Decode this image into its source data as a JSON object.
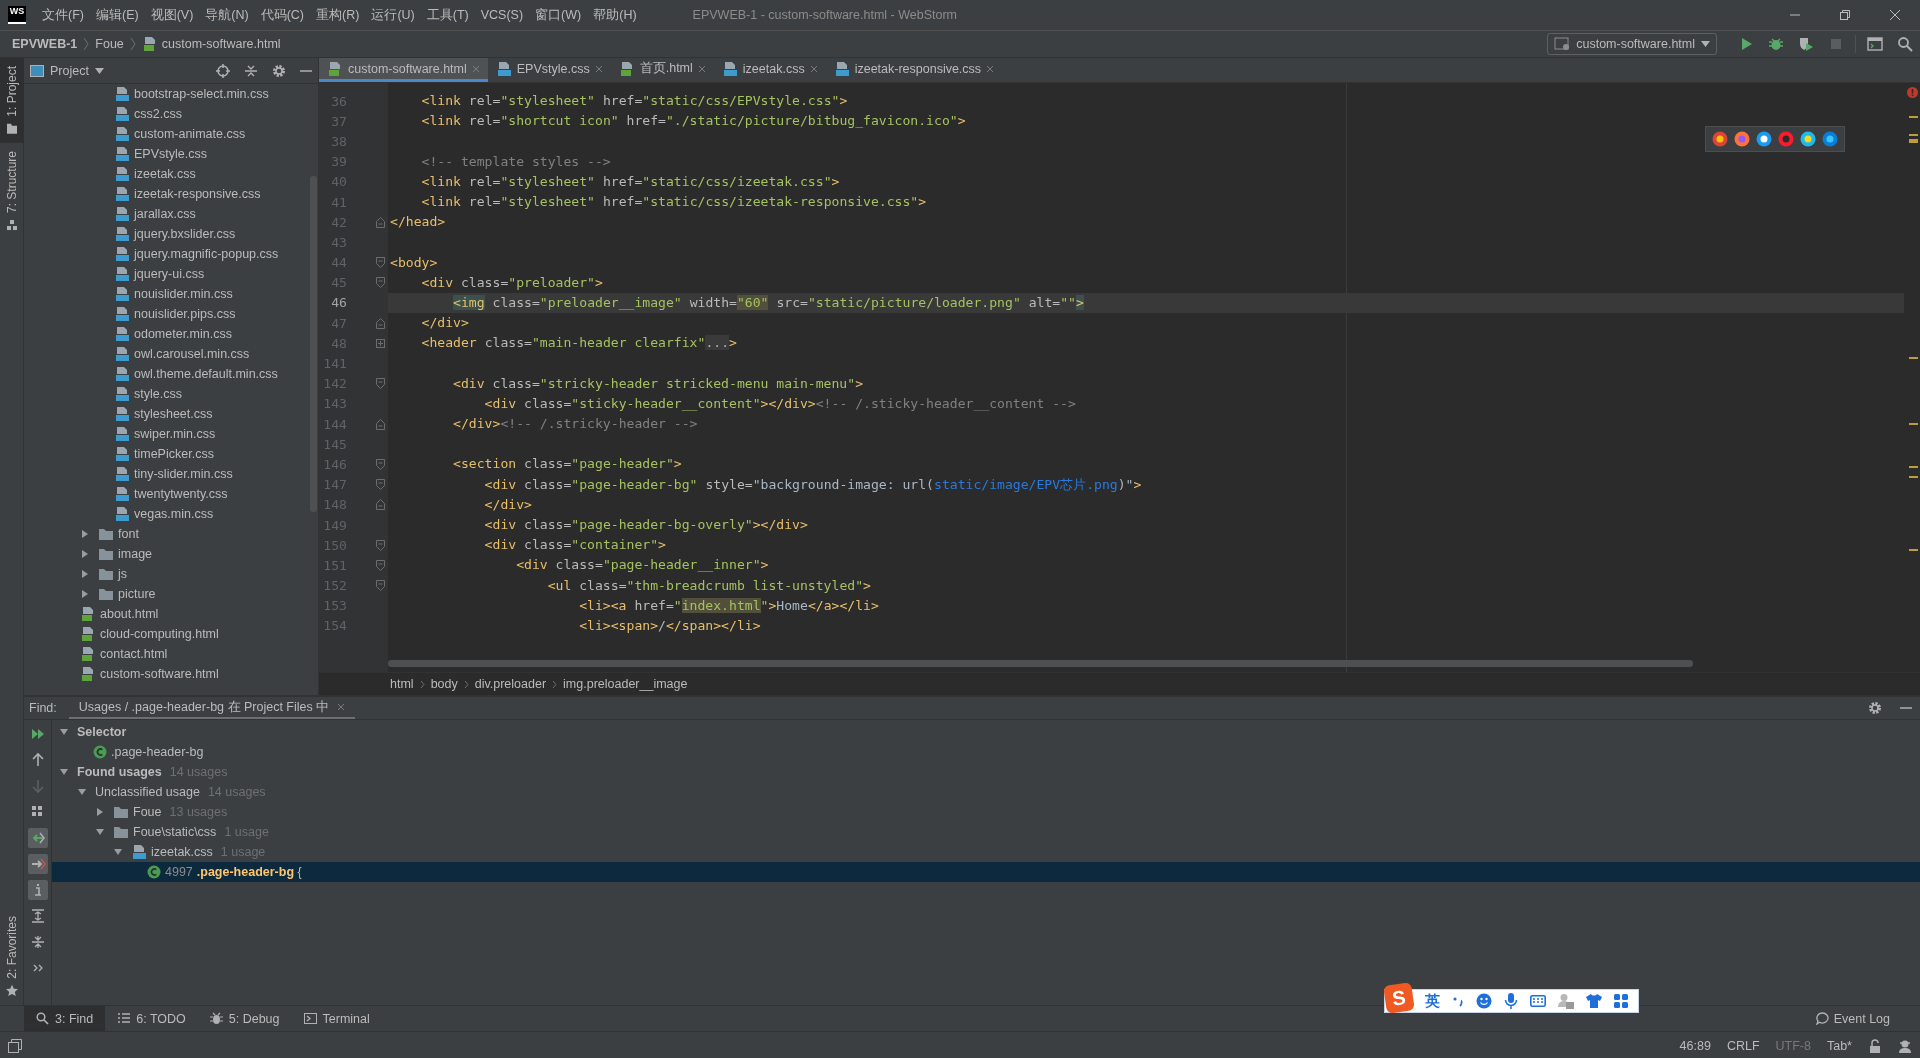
{
  "menu_bar": {
    "logo": "WS",
    "items": [
      "文件(F)",
      "编辑(E)",
      "视图(V)",
      "导航(N)",
      "代码(C)",
      "重构(R)",
      "运行(U)",
      "工具(T)",
      "VCS(S)",
      "窗口(W)",
      "帮助(H)"
    ],
    "title": "EPVWEB-1 - custom-software.html - WebStorm"
  },
  "nav_bar": {
    "breadcrumbs": [
      {
        "label": "EPVWEB-1",
        "kind": "project"
      },
      {
        "label": "Foue",
        "kind": "folder"
      },
      {
        "label": "custom-software.html",
        "kind": "html"
      }
    ],
    "run_config": "custom-software.html",
    "buttons": [
      {
        "kind": "run",
        "disabled": false
      },
      {
        "kind": "debug",
        "disabled": false
      },
      {
        "kind": "coverage",
        "disabled": false
      },
      {
        "kind": "stop",
        "disabled": true
      },
      {
        "kind": "terminal",
        "disabled": false
      },
      {
        "kind": "search",
        "disabled": false
      }
    ]
  },
  "side_strip": {
    "top": [
      {
        "label": "1: Project",
        "kind": "project",
        "selected": true
      },
      {
        "label": "7: Structure",
        "kind": "structure",
        "selected": false
      }
    ],
    "bottom": [
      {
        "label": "2: Favorites",
        "kind": "favorites",
        "selected": false
      }
    ]
  },
  "project_panel": {
    "title": "Project",
    "tree": [
      {
        "children": [
          {
            "children": [
              {
                "label": "bootstrap-select.min.css",
                "kind": "css"
              },
              {
                "label": "css2.css",
                "kind": "css"
              },
              {
                "label": "custom-animate.css",
                "kind": "css"
              },
              {
                "label": "EPVstyle.css",
                "kind": "css"
              },
              {
                "label": "izeetak.css",
                "kind": "css"
              },
              {
                "label": "izeetak-responsive.css",
                "kind": "css"
              },
              {
                "label": "jarallax.css",
                "kind": "css"
              },
              {
                "label": "jquery.bxslider.css",
                "kind": "css"
              },
              {
                "label": "jquery.magnific-popup.css",
                "kind": "css"
              },
              {
                "label": "jquery-ui.css",
                "kind": "css"
              },
              {
                "label": "nouislider.min.css",
                "kind": "css"
              },
              {
                "label": "nouislider.pips.css",
                "kind": "css"
              },
              {
                "label": "odometer.min.css",
                "kind": "css"
              },
              {
                "label": "owl.carousel.min.css",
                "kind": "css"
              },
              {
                "label": "owl.theme.default.min.css",
                "kind": "css"
              },
              {
                "label": "style.css",
                "kind": "css"
              },
              {
                "label": "stylesheet.css",
                "kind": "css"
              },
              {
                "label": "swiper.min.css",
                "kind": "css"
              },
              {
                "label": "timePicker.css",
                "kind": "css"
              },
              {
                "label": "tiny-slider.min.css",
                "kind": "css"
              },
              {
                "label": "twentytwenty.css",
                "kind": "css"
              },
              {
                "label": "vegas.min.css",
                "kind": "css"
              }
            ]
          }
        ]
      },
      {
        "label": "font",
        "kind": "folder",
        "expanded": false
      },
      {
        "label": "image",
        "kind": "folder",
        "expanded": false
      },
      {
        "label": "js",
        "kind": "folder",
        "expanded": false
      },
      {
        "label": "picture",
        "kind": "folder",
        "expanded": false
      },
      {
        "label": "about.html",
        "kind": "html"
      },
      {
        "label": "cloud-computing.html",
        "kind": "html"
      },
      {
        "label": "contact.html",
        "kind": "html"
      },
      {
        "label": "custom-software.html",
        "kind": "html"
      }
    ]
  },
  "editor_tabs": [
    {
      "label": "custom-software.html",
      "kind": "html",
      "selected": true
    },
    {
      "label": "EPVstyle.css",
      "kind": "css",
      "selected": false
    },
    {
      "label": "首页.html",
      "kind": "html",
      "selected": false
    },
    {
      "label": "izeetak.css",
      "kind": "css",
      "selected": false
    },
    {
      "label": "izeetak-responsive.css",
      "kind": "css",
      "selected": false
    }
  ],
  "editor": {
    "lines": [
      {
        "number": "36",
        "current": false,
        "segments": [
          {
            "kind": "tag",
            "text": "    <link "
          },
          {
            "kind": "attr",
            "text": "rel="
          },
          {
            "kind": "str",
            "text": "\"stylesheet\""
          },
          {
            "kind": "attr",
            "text": " href="
          },
          {
            "kind": "str",
            "text": "\"static/css/EPVstyle.css\""
          },
          {
            "kind": "tag",
            "text": ">"
          }
        ]
      },
      {
        "number": "37",
        "current": false,
        "segments": [
          {
            "kind": "tag",
            "text": "    <link "
          },
          {
            "kind": "attr",
            "text": "rel="
          },
          {
            "kind": "str",
            "text": "\"shortcut icon\""
          },
          {
            "kind": "attr",
            "text": " href="
          },
          {
            "kind": "str",
            "text": "\"./static/picture/bitbug_favicon.ico\""
          },
          {
            "kind": "tag",
            "text": ">"
          }
        ]
      },
      {
        "number": "38",
        "current": false,
        "kind": "plain"
      },
      {
        "number": "39",
        "current": false,
        "segments": [
          {
            "kind": "comment",
            "text": "    <!-- template styles -->"
          }
        ]
      },
      {
        "number": "40",
        "current": false,
        "segments": [
          {
            "kind": "tag",
            "text": "    <link "
          },
          {
            "kind": "attr",
            "text": "rel="
          },
          {
            "kind": "str",
            "text": "\"stylesheet\""
          },
          {
            "kind": "attr",
            "text": " href="
          },
          {
            "kind": "str",
            "text": "\"static/css/izeetak.css\""
          },
          {
            "kind": "tag",
            "text": ">"
          }
        ]
      },
      {
        "number": "41",
        "current": false,
        "segments": [
          {
            "kind": "tag",
            "text": "    <link "
          },
          {
            "kind": "attr",
            "text": "rel="
          },
          {
            "kind": "str",
            "text": "\"stylesheet\""
          },
          {
            "kind": "attr",
            "text": " href="
          },
          {
            "kind": "str",
            "text": "\"static/css/izeetak-responsive.css\""
          },
          {
            "kind": "tag",
            "text": ">"
          }
        ]
      },
      {
        "number": "42",
        "current": false,
        "kind": "fold_end",
        "segments": [
          {
            "kind": "tag",
            "text": "</head>"
          }
        ]
      },
      {
        "number": "43",
        "current": false,
        "kind": "plain"
      },
      {
        "number": "44",
        "current": false,
        "kind": "fold_start",
        "segments": [
          {
            "kind": "tag",
            "text": "<body>"
          }
        ]
      },
      {
        "number": "45",
        "current": false,
        "kind": "fold_start",
        "segments": [
          {
            "kind": "tag",
            "text": "    <div "
          },
          {
            "kind": "attr",
            "text": "class="
          },
          {
            "kind": "str",
            "text": "\"preloader\""
          },
          {
            "kind": "tag",
            "text": ">"
          }
        ]
      },
      {
        "number": "46",
        "current": true,
        "segments": [
          {
            "kind": "match",
            "text": "        <img"
          },
          {
            "kind": "attr",
            "text": " class="
          },
          {
            "kind": "str",
            "text": "\"preloader__image\""
          },
          {
            "kind": "attr",
            "text": " width="
          },
          {
            "kind": "str_hl",
            "text": "\"60\""
          },
          {
            "kind": "attr",
            "text": " src="
          },
          {
            "kind": "str",
            "text": "\"static/picture/loader.png\""
          },
          {
            "kind": "attr",
            "text": " alt="
          },
          {
            "kind": "str",
            "text": "\"\""
          },
          {
            "kind": "match",
            "text": ">"
          }
        ]
      },
      {
        "number": "47",
        "current": false,
        "kind": "fold_end",
        "segments": [
          {
            "kind": "tag",
            "text": "    </div>"
          }
        ]
      },
      {
        "number": "48",
        "current": false,
        "kind": "collapsed",
        "segments": [
          {
            "kind": "tag",
            "text": "    <header "
          },
          {
            "kind": "attr",
            "text": "class="
          },
          {
            "kind": "str",
            "text": "\"main-header clearfix\""
          },
          {
            "kind": "folded",
            "text": "..."
          },
          {
            "kind": "tag",
            "text": ">"
          }
        ]
      },
      {
        "number": "141",
        "current": false,
        "kind": "plain"
      },
      {
        "number": "142",
        "current": false,
        "kind": "fold_start",
        "segments": [
          {
            "kind": "tag",
            "text": "        <div "
          },
          {
            "kind": "attr",
            "text": "class="
          },
          {
            "kind": "str",
            "text": "\"stricky-header stricked-menu main-menu\""
          },
          {
            "kind": "tag",
            "text": ">"
          }
        ]
      },
      {
        "number": "143",
        "current": false,
        "segments": [
          {
            "kind": "tag",
            "text": "            <div "
          },
          {
            "kind": "attr",
            "text": "class="
          },
          {
            "kind": "str",
            "text": "\"sticky-header__content\""
          },
          {
            "kind": "tag",
            "text": "></div>"
          },
          {
            "kind": "comment",
            "text": "<!-- /.sticky-header__content -->"
          }
        ]
      },
      {
        "number": "144",
        "current": false,
        "kind": "fold_end",
        "segments": [
          {
            "kind": "tag",
            "text": "        </div>"
          },
          {
            "kind": "comment",
            "text": "<!-- /.stricky-header -->"
          }
        ]
      },
      {
        "number": "145",
        "current": false,
        "kind": "plain"
      },
      {
        "number": "146",
        "current": false,
        "kind": "fold_start",
        "segments": [
          {
            "kind": "tag",
            "text": "        <section "
          },
          {
            "kind": "attr",
            "text": "class="
          },
          {
            "kind": "str",
            "text": "\"page-header\""
          },
          {
            "kind": "tag",
            "text": ">"
          }
        ]
      },
      {
        "number": "147",
        "current": false,
        "kind": "fold_start",
        "segments": [
          {
            "kind": "tag",
            "text": "            <div "
          },
          {
            "kind": "attr",
            "text": "class="
          },
          {
            "kind": "str",
            "text": "\"page-header-bg\""
          },
          {
            "kind": "attr",
            "text": " style="
          },
          {
            "kind": "text",
            "text": "\"background-image: url("
          },
          {
            "kind": "url",
            "text": "static/image/EPV芯片.png"
          },
          {
            "kind": "text",
            "text": ")\""
          },
          {
            "kind": "tag",
            "text": ">"
          }
        ]
      },
      {
        "number": "148",
        "current": false,
        "kind": "fold_end",
        "segments": [
          {
            "kind": "tag",
            "text": "            </div>"
          }
        ]
      },
      {
        "number": "149",
        "current": false,
        "segments": [
          {
            "kind": "tag",
            "text": "            <div "
          },
          {
            "kind": "attr",
            "text": "class="
          },
          {
            "kind": "str",
            "text": "\"page-header-bg-overly\""
          },
          {
            "kind": "tag",
            "text": "></div>"
          }
        ]
      },
      {
        "number": "150",
        "current": false,
        "kind": "fold_start",
        "segments": [
          {
            "kind": "tag",
            "text": "            <div "
          },
          {
            "kind": "attr",
            "text": "class="
          },
          {
            "kind": "str",
            "text": "\"container\""
          },
          {
            "kind": "tag",
            "text": ">"
          }
        ]
      },
      {
        "number": "151",
        "current": false,
        "kind": "fold_start",
        "segments": [
          {
            "kind": "tag",
            "text": "                <div "
          },
          {
            "kind": "attr",
            "text": "class="
          },
          {
            "kind": "str",
            "text": "\"page-header__inner\""
          },
          {
            "kind": "tag",
            "text": ">"
          }
        ]
      },
      {
        "number": "152",
        "current": false,
        "kind": "fold_start",
        "segments": [
          {
            "kind": "tag",
            "text": "                    <ul "
          },
          {
            "kind": "attr",
            "text": "class="
          },
          {
            "kind": "str",
            "text": "\"thm-breadcrumb list-unstyled\""
          },
          {
            "kind": "tag",
            "text": ">"
          }
        ]
      },
      {
        "number": "153",
        "current": false,
        "segments": [
          {
            "kind": "tag",
            "text": "                        <li><a "
          },
          {
            "kind": "attr",
            "text": "href="
          },
          {
            "kind": "str",
            "text": "\""
          },
          {
            "kind": "str_hl",
            "text": "index.html"
          },
          {
            "kind": "str",
            "text": "\""
          },
          {
            "kind": "tag",
            "text": ">"
          },
          {
            "kind": "text",
            "text": "Home"
          },
          {
            "kind": "tag",
            "text": "</a></li>"
          }
        ]
      },
      {
        "number": "154",
        "current": false,
        "segments": [
          {
            "kind": "tag",
            "text": "                        <li><span>"
          },
          {
            "kind": "text",
            "text": "/"
          },
          {
            "kind": "tag",
            "text": "</span></li>"
          }
        ]
      }
    ],
    "breadcrumbs": [
      "html",
      "body",
      "div.preloader",
      "img.preloader__image"
    ]
  },
  "find_panel": {
    "label": "Find:",
    "tab": "Usages / .page-header-bg 在 Project Files 中",
    "toolbar": [
      {
        "kind": "rerun",
        "on": false,
        "disabled": false
      },
      {
        "kind": "up",
        "on": false,
        "disabled": false
      },
      {
        "kind": "down",
        "on": false,
        "disabled": true
      },
      {
        "kind": "group",
        "on": false,
        "disabled": false
      },
      {
        "kind": "import",
        "on": true,
        "disabled": false
      },
      {
        "kind": "export",
        "on": true,
        "disabled": false
      },
      {
        "kind": "info",
        "on": true,
        "disabled": false
      },
      {
        "kind": "expand",
        "on": false,
        "disabled": false
      },
      {
        "kind": "collapse",
        "on": false,
        "disabled": false
      },
      {
        "kind": "more",
        "on": false,
        "disabled": false
      }
    ],
    "tree": [
      {
        "kind": "group",
        "label": "Selector",
        "expanded": true,
        "selected": false,
        "children": [
          {
            "kind": "selector",
            "label": ".page-header-bg",
            "selected": false
          }
        ]
      },
      {
        "kind": "group",
        "label": "Found usages",
        "count": "14 usages",
        "expanded": true,
        "selected": false,
        "children": [
          {
            "kind": "category",
            "label": "Unclassified usage",
            "count": "14 usages",
            "expanded": true,
            "selected": false,
            "children": [
              {
                "kind": "folder",
                "label": "Foue",
                "count": "13 usages",
                "expanded": false,
                "selected": false
              },
              {
                "kind": "folder",
                "label": "Foue\\static\\css",
                "count": "1 usage",
                "expanded": true,
                "selected": false,
                "children": [
                  {
                    "kind": "file",
                    "label": "izeetak.css",
                    "count": "1 usage",
                    "expanded": true,
                    "selected": false,
                    "children": [
                      {
                        "kind": "usage",
                        "line": "4997",
                        "label": "**.page-header-bg** {",
                        "selected": true
                      }
                    ]
                  }
                ]
              }
            ]
          }
        ]
      }
    ]
  },
  "tool_tabs": [
    {
      "label": "3: Find",
      "kind": "find",
      "selected": true
    },
    {
      "label": "6: TODO",
      "kind": "todo",
      "selected": false
    },
    {
      "label": "5: Debug",
      "kind": "debug",
      "selected": false
    },
    {
      "label": "Terminal",
      "kind": "terminal",
      "selected": false
    }
  ],
  "event_log": "Event Log",
  "status_bar": {
    "items": [
      {
        "text": "46:89",
        "muted": false
      },
      {
        "text": "CRLF",
        "muted": false
      },
      {
        "text": "UTF-8",
        "muted": true
      },
      {
        "text": "Tab*",
        "muted": false
      }
    ]
  },
  "ime_bar": {
    "logo": "S",
    "mode": "英"
  }
}
